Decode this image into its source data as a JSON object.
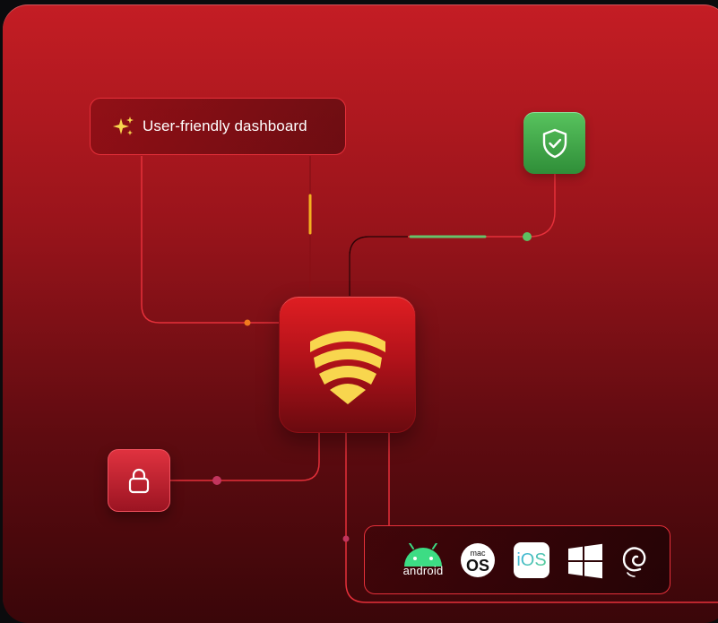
{
  "dashboard_card": {
    "label": "User-friendly dashboard"
  },
  "os_bar": {
    "android_label": "android",
    "macos_small": "mac",
    "macos_big": "OS",
    "ios_label": "iOS"
  },
  "colors": {
    "brand_red": "#c41d24",
    "accent_yellow": "#f8d64e",
    "success_green": "#4caf50",
    "wire_red": "#e5303a",
    "node_orange": "#f07a1e",
    "node_pink": "#c2355d"
  },
  "icons": {
    "dashboard": "sparkles-icon",
    "security": "shield-check-icon",
    "center": "brand-shield-logo",
    "lock": "lock-icon",
    "platforms": [
      "android-icon",
      "macos-icon",
      "ios-icon",
      "windows-icon",
      "debian-icon"
    ]
  }
}
